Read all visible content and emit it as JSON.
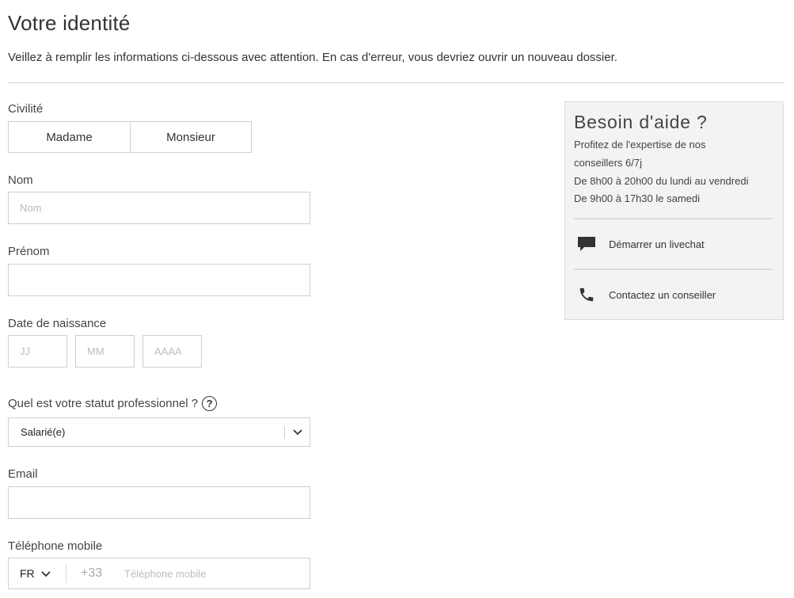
{
  "page": {
    "title": "Votre identité",
    "intro": "Veillez à remplir les informations ci-dessous avec attention. En cas d'erreur, vous devriez ouvrir un nouveau dossier."
  },
  "form": {
    "civility": {
      "label": "Civilité",
      "options": [
        "Madame",
        "Monsieur"
      ]
    },
    "last_name": {
      "label": "Nom",
      "placeholder": "Nom",
      "value": ""
    },
    "first_name": {
      "label": "Prénom",
      "placeholder": "",
      "value": ""
    },
    "birth_date": {
      "label": "Date de naissance",
      "day_placeholder": "JJ",
      "month_placeholder": "MM",
      "year_placeholder": "AAAA"
    },
    "professional_status": {
      "label": "Quel est votre statut professionnel ?",
      "help_icon": "question-circle-icon",
      "help_glyph": "?",
      "selected": "Salarié(e)"
    },
    "email": {
      "label": "Email",
      "placeholder": "",
      "value": ""
    },
    "mobile": {
      "label": "Téléphone mobile",
      "country": "FR",
      "prefix": "+33",
      "placeholder": "Téléphone mobile"
    }
  },
  "help": {
    "title": "Besoin d'aide ?",
    "lines": [
      "Profitez de l'expertise de nos",
      "conseillers 6/7j",
      "De 8h00 à 20h00 du lundi au vendredi",
      "De 9h00 à 17h30 le samedi"
    ],
    "actions": [
      {
        "label": "Démarrer un livechat",
        "icon": "chat-bubble-icon"
      },
      {
        "label": "Contactez un conseiller",
        "icon": "phone-icon"
      }
    ]
  },
  "colors": {
    "text": "#333333",
    "border": "#cfcfcf",
    "panel_bg": "#f3f3f3",
    "placeholder": "#b9b9b9"
  }
}
